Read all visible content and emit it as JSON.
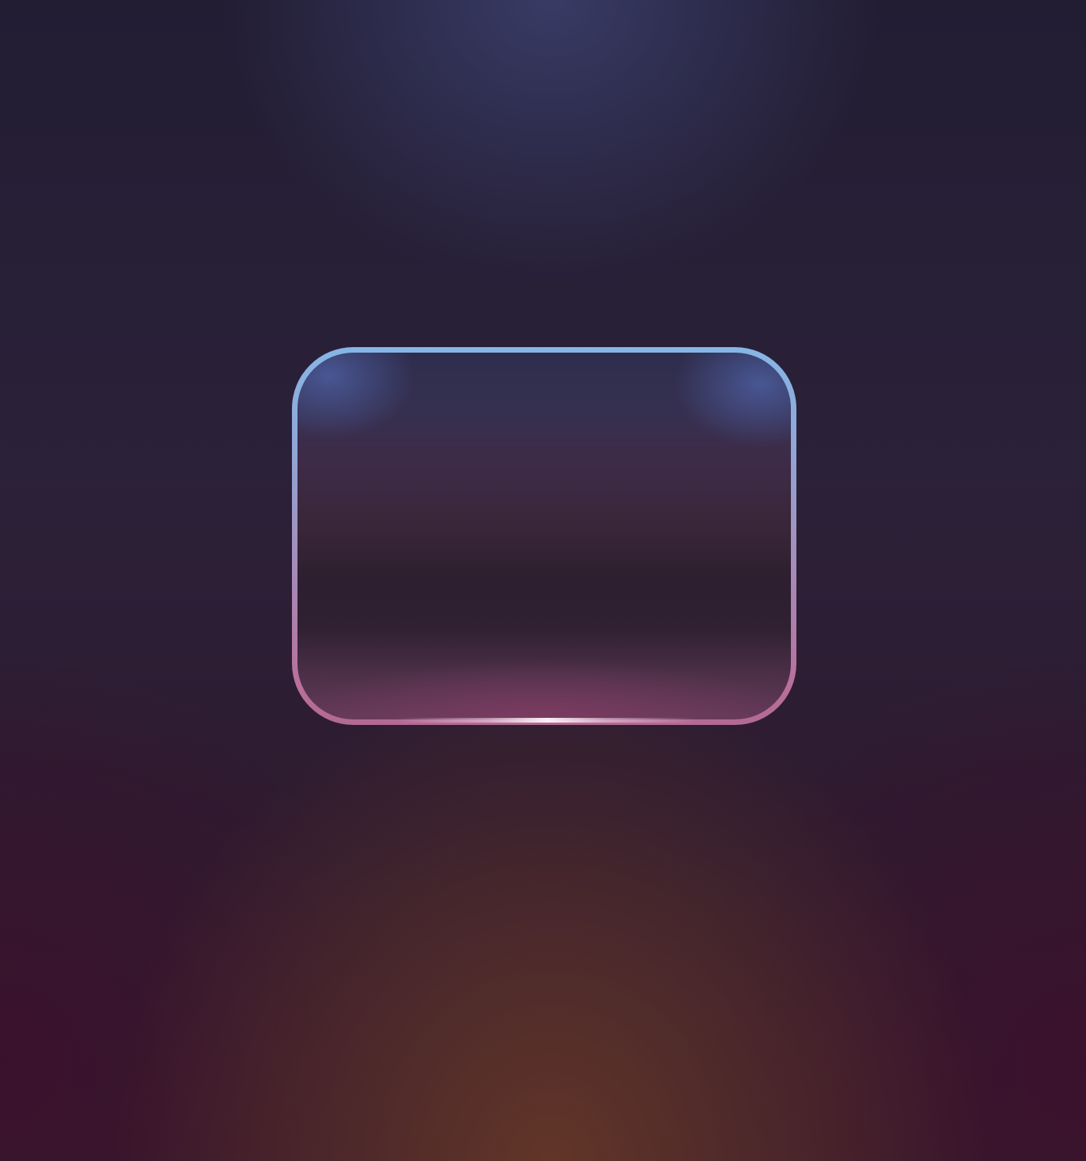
{
  "background": {
    "top_glow_color": "#3c406e",
    "bottom_glow_color": "#643728",
    "base_color_top": "#221d33",
    "base_color_bottom": "#361a2c"
  },
  "glass_card": {
    "border_gradient": [
      "#86b6e6",
      "#a78ab8",
      "#b26a94"
    ],
    "fill_top": "#2e2d4d",
    "fill_bottom": "#633a58",
    "highlight_color": "#fff8fc"
  }
}
